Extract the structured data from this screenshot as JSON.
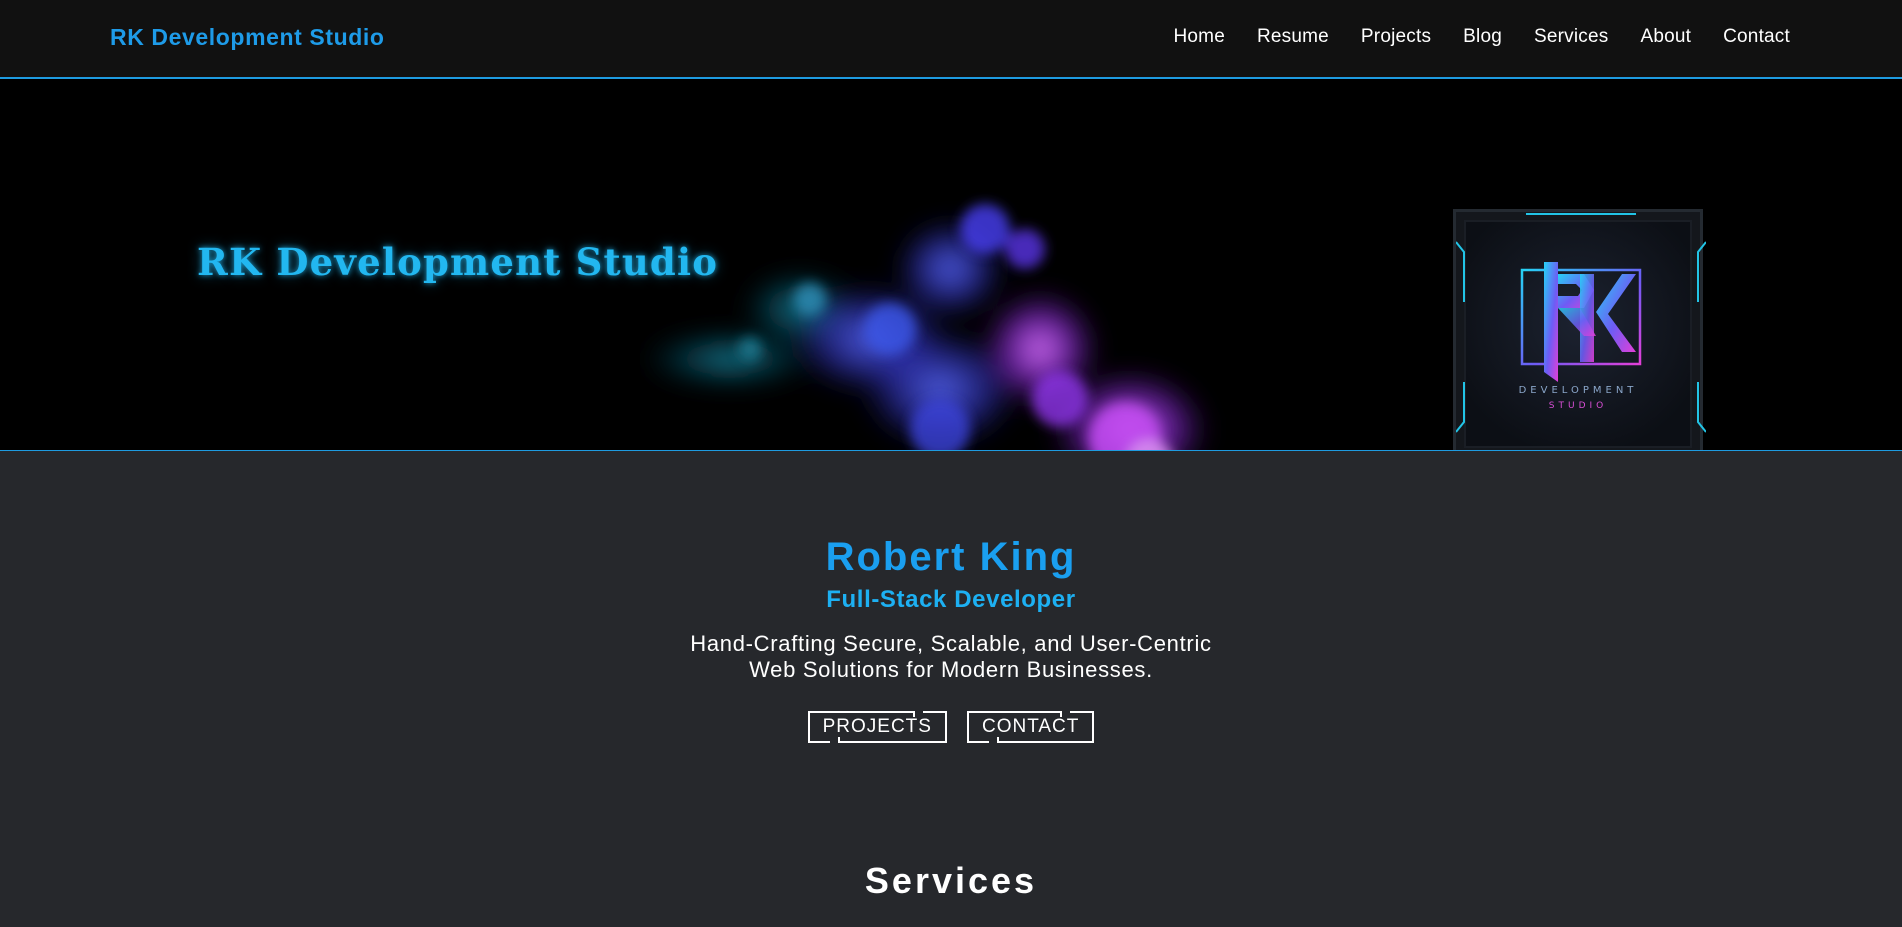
{
  "navbar": {
    "brand": "RK Development Studio",
    "links": [
      "Home",
      "Resume",
      "Projects",
      "Blog",
      "Services",
      "About",
      "Contact"
    ]
  },
  "hero": {
    "title": "RK Development Studio",
    "logo": {
      "monogram": "RK",
      "line1": "DEVELOPMENT",
      "line2": "STUDIO"
    }
  },
  "intro": {
    "name": "Robert King",
    "role": "Full-Stack Developer",
    "tagline_line1": "Hand-Crafting Secure, Scalable, and User-Centric",
    "tagline_line2": "Web Solutions for Modern Businesses.",
    "buttons": [
      "PROJECTS",
      "CONTACT"
    ]
  },
  "services": {
    "heading": "Services"
  },
  "colors": {
    "accent": "#1e9be8",
    "hero_title": "#22b7f0",
    "page_bg": "#26282c",
    "nav_bg": "#111111"
  }
}
